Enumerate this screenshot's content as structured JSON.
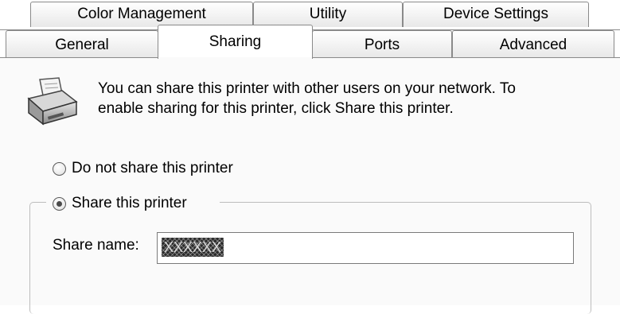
{
  "tabs_top": [
    {
      "label": "Color Management"
    },
    {
      "label": "Utility"
    },
    {
      "label": "Device Settings"
    }
  ],
  "tabs_bottom": [
    {
      "label": "General"
    },
    {
      "label": "Sharing",
      "active": true
    },
    {
      "label": "Ports"
    },
    {
      "label": "Advanced"
    }
  ],
  "info": {
    "icon": "printer-icon",
    "line1": "You can share this printer with other users on your network.  To",
    "line2": "enable sharing for this printer, click Share this printer."
  },
  "options": {
    "do_not_share": {
      "label": "Do not share this printer",
      "checked": false
    },
    "share": {
      "label": "Share this printer",
      "checked": true
    }
  },
  "share_name": {
    "label": "Share name:",
    "value": "XXXXXX"
  }
}
